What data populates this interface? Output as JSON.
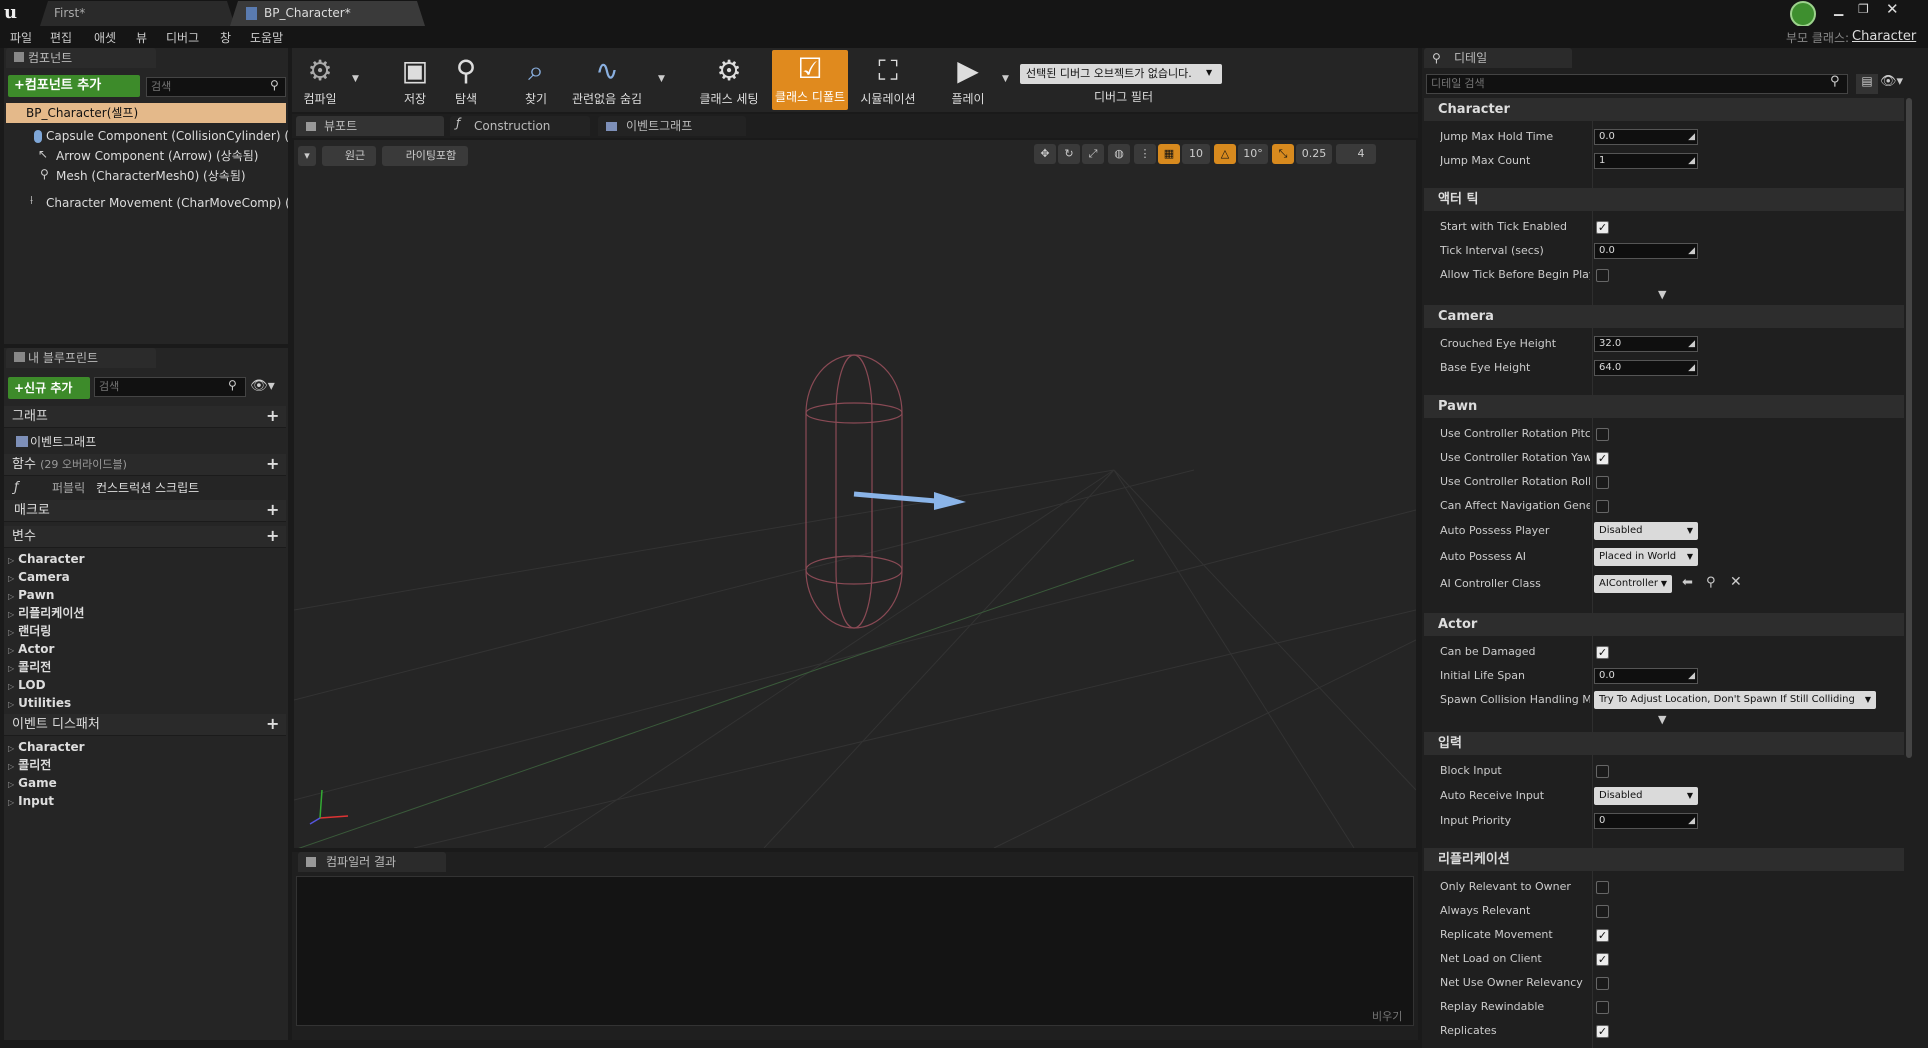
{
  "window": {
    "tabs": [
      "First*",
      "BP_Character*"
    ],
    "parent_class_label": "부모 클래스:",
    "parent_class": "Character"
  },
  "menu": [
    "파일",
    "편집",
    "애셋",
    "뷰",
    "디버그",
    "창",
    "도움말"
  ],
  "components": {
    "tab": "컴포넌트",
    "add_button": "+컴포넌트 추가",
    "search_placeholder": "검색",
    "root": "BP_Character(셀프)",
    "items": [
      "Capsule Component (CollisionCylinder) (상속",
      "Arrow Component (Arrow) (상속됨)",
      "Mesh (CharacterMesh0) (상속됨)",
      "Character Movement (CharMoveComp) (상속"
    ]
  },
  "blueprint": {
    "tab": "내 블루프린트",
    "add_button": "+신규 추가",
    "search_placeholder": "검색",
    "graph_header": "그래프",
    "event_graph": "이벤트그래프",
    "functions_header": "함수",
    "functions_count": "(29 오버라이드블)",
    "construction_public": "퍼블릭",
    "construction_script": "컨스트럭션 스크립트",
    "macros_header": "매크로",
    "variables_header": "변수",
    "variables": [
      "Character",
      "Camera",
      "Pawn",
      "리플리케이션",
      "랜더링",
      "Actor",
      "콜리전",
      "LOD",
      "Utilities"
    ],
    "dispatchers_header": "이벤트 디스패처",
    "dispatchers": [
      "Character",
      "콜리전",
      "Game",
      "Input"
    ]
  },
  "toolbar": {
    "compile": "컴파일",
    "save": "저장",
    "browse": "탐색",
    "find": "찾기",
    "hide_unrelated": "관련없음 숨김",
    "class_settings": "클래스 세팅",
    "class_defaults": "클래스 디폴트",
    "simulation": "시뮬레이션",
    "play": "플레이",
    "debug_object": "선택된 디버그 오브젝트가 없습니다.",
    "debug_filter": "디버그 필터"
  },
  "editor_tabs": [
    "뷰포트",
    "Construction Scrip",
    "이벤트그래프"
  ],
  "viewport": {
    "perspective": "원근",
    "lit": "라이팅포함",
    "grid_snap": "10",
    "rot_snap": "10°",
    "scale_snap": "0.25",
    "cam_speed": "4"
  },
  "compiler": {
    "tab": "컴파일러 결과",
    "clear": "비우기"
  },
  "details": {
    "tab": "디테일",
    "search_placeholder": "디테일 검색",
    "character": {
      "title": "Character",
      "jump_max_hold_time": "Jump Max Hold Time",
      "jump_max_hold_time_val": "0.0",
      "jump_max_count": "Jump Max Count",
      "jump_max_count_val": "1"
    },
    "actor_tick": {
      "title": "액터 틱",
      "start_tick": "Start with Tick Enabled",
      "tick_interval": "Tick Interval (secs)",
      "tick_interval_val": "0.0",
      "allow_tick": "Allow Tick Before Begin Play"
    },
    "camera": {
      "title": "Camera",
      "crouched_eye": "Crouched Eye Height",
      "crouched_eye_val": "32.0",
      "base_eye": "Base Eye Height",
      "base_eye_val": "64.0"
    },
    "pawn": {
      "title": "Pawn",
      "pitch": "Use Controller Rotation Pitch",
      "yaw": "Use Controller Rotation Yaw",
      "roll": "Use Controller Rotation Roll",
      "nav": "Can Affect Navigation Generat",
      "auto_player": "Auto Possess Player",
      "auto_player_val": "Disabled",
      "auto_ai": "Auto Possess AI",
      "auto_ai_val": "Placed in World",
      "ai_class": "AI Controller Class",
      "ai_class_val": "AIController"
    },
    "actor": {
      "title": "Actor",
      "damaged": "Can be Damaged",
      "life_span": "Initial Life Span",
      "life_span_val": "0.0",
      "spawn": "Spawn Collision Handling Met",
      "spawn_val": "Try To Adjust Location, Don't Spawn If Still Colliding"
    },
    "input": {
      "title": "입력",
      "block": "Block Input",
      "auto_receive": "Auto Receive Input",
      "auto_receive_val": "Disabled",
      "priority": "Input Priority",
      "priority_val": "0"
    },
    "replication": {
      "title": "리플리케이션",
      "only_owner": "Only Relevant to Owner",
      "always": "Always Relevant",
      "rep_movement": "Replicate Movement",
      "net_load": "Net Load on Client",
      "net_owner": "Net Use Owner Relevancy",
      "replay": "Replay Rewindable",
      "replicates": "Replicates"
    }
  }
}
